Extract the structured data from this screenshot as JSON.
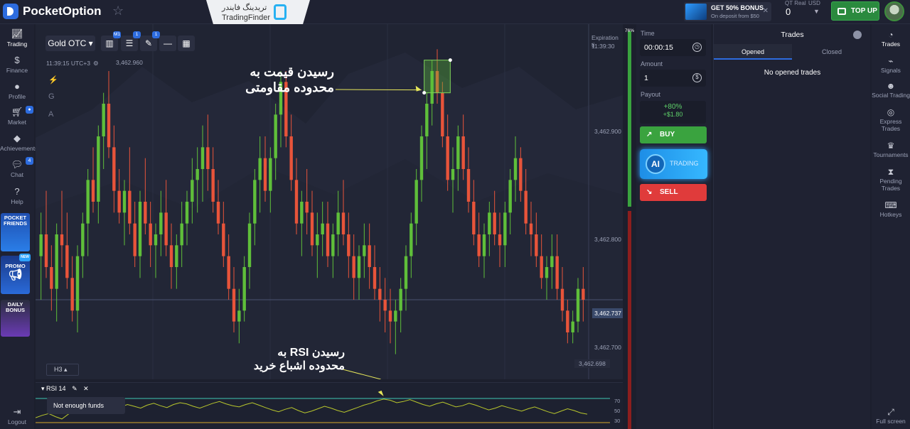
{
  "header": {
    "brand": "PocketOption",
    "watermark_fa": "تریدینگ فایندر",
    "watermark_en": "TradingFinder",
    "bonus_title": "GET 50% BONUS",
    "bonus_sub": "On deposit from $50",
    "account_type": "QT Real",
    "currency": "USD",
    "balance": "0",
    "topup_label": "TOP UP",
    "icons": {
      "favorite": "star-icon",
      "close": "close-icon",
      "topup": "wallet-icon"
    }
  },
  "left_nav": {
    "items": [
      {
        "label": "Trading",
        "icon": "chart-icon"
      },
      {
        "label": "Finance",
        "icon": "dollar-icon"
      },
      {
        "label": "Profile",
        "icon": "user-icon"
      },
      {
        "label": "Market",
        "icon": "cart-icon",
        "badge": ""
      },
      {
        "label": "Achievements",
        "icon": "diamond-icon"
      },
      {
        "label": "Chat",
        "icon": "chat-icon",
        "badge": "4"
      },
      {
        "label": "Help",
        "icon": "help-icon"
      }
    ],
    "promos": [
      {
        "label": "POCKET FRIENDS",
        "badge": ""
      },
      {
        "label": "PROMO",
        "badge": "NEW"
      },
      {
        "label": "DAILY BONUS",
        "badge": ""
      }
    ],
    "logout": "Logout"
  },
  "chart": {
    "asset": "Gold OTC",
    "toolbar_badges": [
      "M1",
      "1",
      "1"
    ],
    "time": "11:39:15 UTC+3",
    "price_top": "3,462.960",
    "side_tools": [
      "⚡",
      "G",
      "A"
    ],
    "expiration_label": "Expiration ti",
    "expiration_time": "11:39:30",
    "axis_prices": [
      "3,462.900",
      "3,462.800",
      "3,462.700"
    ],
    "current_price": "3,462.737",
    "low_price": "3,462.698",
    "timeframe": "H3",
    "annotation_top_fa": "رسیدن قیمت به\nمحدوده مقاومتی",
    "annotation_bottom_fa": "رسیدن RSI به\nمحدوده اشباع خرید",
    "progress_up_pct": "76%",
    "progress_up": 0.76
  },
  "chart_data": {
    "type": "candlestick",
    "ohlc": [
      [
        3462.78,
        3462.82,
        3462.74,
        3462.8
      ],
      [
        3462.8,
        3462.84,
        3462.76,
        3462.77
      ],
      [
        3462.77,
        3462.79,
        3462.73,
        3462.75
      ],
      [
        3462.75,
        3462.81,
        3462.72,
        3462.8
      ],
      [
        3462.8,
        3462.84,
        3462.77,
        3462.79
      ],
      [
        3462.79,
        3462.82,
        3462.75,
        3462.76
      ],
      [
        3462.76,
        3462.78,
        3462.72,
        3462.73
      ],
      [
        3462.73,
        3462.79,
        3462.71,
        3462.78
      ],
      [
        3462.78,
        3462.82,
        3462.76,
        3462.81
      ],
      [
        3462.81,
        3462.86,
        3462.78,
        3462.85
      ],
      [
        3462.85,
        3462.88,
        3462.82,
        3462.83
      ],
      [
        3462.83,
        3462.9,
        3462.81,
        3462.89
      ],
      [
        3462.89,
        3462.93,
        3462.86,
        3462.92
      ],
      [
        3462.92,
        3462.95,
        3462.87,
        3462.88
      ],
      [
        3462.88,
        3462.9,
        3462.82,
        3462.84
      ],
      [
        3462.84,
        3462.86,
        3462.81,
        3462.82
      ],
      [
        3462.82,
        3462.85,
        3462.79,
        3462.84
      ],
      [
        3462.84,
        3462.88,
        3462.8,
        3462.81
      ],
      [
        3462.81,
        3462.83,
        3462.77,
        3462.78
      ],
      [
        3462.78,
        3462.84,
        3462.76,
        3462.83
      ],
      [
        3462.83,
        3462.87,
        3462.8,
        3462.81
      ],
      [
        3462.81,
        3462.83,
        3462.77,
        3462.79
      ],
      [
        3462.79,
        3462.81,
        3462.76,
        3462.8
      ],
      [
        3462.8,
        3462.84,
        3462.78,
        3462.82
      ],
      [
        3462.82,
        3462.85,
        3462.78,
        3462.79
      ],
      [
        3462.79,
        3462.81,
        3462.75,
        3462.77
      ],
      [
        3462.77,
        3462.8,
        3462.75,
        3462.79
      ],
      [
        3462.79,
        3462.83,
        3462.77,
        3462.81
      ],
      [
        3462.81,
        3462.84,
        3462.79,
        3462.83
      ],
      [
        3462.83,
        3462.87,
        3462.81,
        3462.85
      ],
      [
        3462.85,
        3462.88,
        3462.82,
        3462.86
      ],
      [
        3462.86,
        3462.9,
        3462.83,
        3462.88
      ],
      [
        3462.88,
        3462.91,
        3462.84,
        3462.86
      ],
      [
        3462.86,
        3462.88,
        3462.82,
        3462.83
      ],
      [
        3462.83,
        3462.85,
        3462.8,
        3462.81
      ],
      [
        3462.81,
        3462.83,
        3462.77,
        3462.78
      ],
      [
        3462.78,
        3462.8,
        3462.74,
        3462.75
      ],
      [
        3462.75,
        3462.77,
        3462.71,
        3462.72
      ],
      [
        3462.72,
        3462.75,
        3462.7,
        3462.73
      ],
      [
        3462.73,
        3462.78,
        3462.72,
        3462.77
      ],
      [
        3462.77,
        3462.82,
        3462.75,
        3462.81
      ],
      [
        3462.81,
        3462.86,
        3462.79,
        3462.85
      ],
      [
        3462.85,
        3462.89,
        3462.82,
        3462.87
      ],
      [
        3462.87,
        3462.89,
        3462.83,
        3462.84
      ],
      [
        3462.84,
        3462.88,
        3462.82,
        3462.87
      ],
      [
        3462.87,
        3462.92,
        3462.85,
        3462.91
      ],
      [
        3462.91,
        3462.95,
        3462.88,
        3462.94
      ],
      [
        3462.94,
        3462.95,
        3462.88,
        3462.89
      ],
      [
        3462.89,
        3462.91,
        3462.84,
        3462.85
      ],
      [
        3462.85,
        3462.87,
        3462.8,
        3462.81
      ],
      [
        3462.81,
        3462.84,
        3462.78,
        3462.83
      ],
      [
        3462.83,
        3462.86,
        3462.8,
        3462.82
      ],
      [
        3462.82,
        3462.84,
        3462.78,
        3462.79
      ],
      [
        3462.79,
        3462.82,
        3462.76,
        3462.8
      ],
      [
        3462.8,
        3462.83,
        3462.78,
        3462.81
      ],
      [
        3462.81,
        3462.83,
        3462.77,
        3462.78
      ],
      [
        3462.78,
        3462.81,
        3462.76,
        3462.8
      ],
      [
        3462.8,
        3462.84,
        3462.78,
        3462.82
      ],
      [
        3462.82,
        3462.85,
        3462.79,
        3462.8
      ],
      [
        3462.8,
        3462.82,
        3462.76,
        3462.78
      ],
      [
        3462.78,
        3462.8,
        3462.74,
        3462.76
      ],
      [
        3462.76,
        3462.79,
        3462.74,
        3462.78
      ],
      [
        3462.78,
        3462.81,
        3462.76,
        3462.79
      ],
      [
        3462.79,
        3462.81,
        3462.75,
        3462.77
      ],
      [
        3462.77,
        3462.79,
        3462.74,
        3462.75
      ],
      [
        3462.75,
        3462.77,
        3462.72,
        3462.74
      ],
      [
        3462.74,
        3462.76,
        3462.71,
        3462.73
      ],
      [
        3462.73,
        3462.75,
        3462.7,
        3462.72
      ],
      [
        3462.72,
        3462.74,
        3462.69,
        3462.73
      ],
      [
        3462.73,
        3462.76,
        3462.71,
        3462.75
      ],
      [
        3462.75,
        3462.79,
        3462.73,
        3462.78
      ],
      [
        3462.78,
        3462.82,
        3462.76,
        3462.81
      ],
      [
        3462.81,
        3462.86,
        3462.79,
        3462.85
      ],
      [
        3462.85,
        3462.9,
        3462.83,
        3462.89
      ],
      [
        3462.89,
        3462.93,
        3462.86,
        3462.92
      ],
      [
        3462.92,
        3462.96,
        3462.9,
        3462.95
      ],
      [
        3462.95,
        3462.97,
        3462.92,
        3462.93
      ],
      [
        3462.93,
        3462.94,
        3462.88,
        3462.89
      ],
      [
        3462.89,
        3462.91,
        3462.84,
        3462.85
      ],
      [
        3462.85,
        3462.88,
        3462.82,
        3462.86
      ],
      [
        3462.86,
        3462.9,
        3462.84,
        3462.89
      ],
      [
        3462.89,
        3462.91,
        3462.85,
        3462.86
      ],
      [
        3462.86,
        3462.88,
        3462.82,
        3462.83
      ],
      [
        3462.83,
        3462.85,
        3462.79,
        3462.8
      ],
      [
        3462.8,
        3462.82,
        3462.77,
        3462.78
      ],
      [
        3462.78,
        3462.81,
        3462.76,
        3462.8
      ],
      [
        3462.8,
        3462.83,
        3462.78,
        3462.82
      ],
      [
        3462.82,
        3462.84,
        3462.79,
        3462.8
      ],
      [
        3462.8,
        3462.82,
        3462.77,
        3462.79
      ],
      [
        3462.79,
        3462.83,
        3462.77,
        3462.82
      ],
      [
        3462.82,
        3462.86,
        3462.8,
        3462.85
      ],
      [
        3462.85,
        3462.89,
        3462.83,
        3462.87
      ],
      [
        3462.87,
        3462.88,
        3462.83,
        3462.84
      ],
      [
        3462.84,
        3462.86,
        3462.8,
        3462.81
      ],
      [
        3462.81,
        3462.83,
        3462.78,
        3462.8
      ],
      [
        3462.8,
        3462.82,
        3462.77,
        3462.78
      ],
      [
        3462.78,
        3462.8,
        3462.75,
        3462.76
      ],
      [
        3462.76,
        3462.78,
        3462.74,
        3462.77
      ],
      [
        3462.77,
        3462.8,
        3462.75,
        3462.78
      ],
      [
        3462.78,
        3462.8,
        3462.74,
        3462.75
      ],
      [
        3462.75,
        3462.77,
        3462.72,
        3462.73
      ],
      [
        3462.73,
        3462.74,
        3462.7,
        3462.71
      ],
      [
        3462.71,
        3462.73,
        3462.7,
        3462.72
      ],
      [
        3462.72,
        3462.76,
        3462.71,
        3462.75
      ],
      [
        3462.75,
        3462.77,
        3462.72,
        3462.74
      ]
    ],
    "ylim": [
      3462.68,
      3462.98
    ],
    "bull_color": "#5fbf3a",
    "bear_color": "#e8543a",
    "resistance_zone": [
      3462.93,
      3462.96
    ]
  },
  "rsi": {
    "label": "RSI 14",
    "tooltip": "Not enough funds",
    "levels": [
      "70",
      "50",
      "30"
    ],
    "values": [
      38,
      42,
      45,
      40,
      36,
      44,
      50,
      47,
      52,
      55,
      49,
      53,
      58,
      56,
      60,
      57,
      54,
      59,
      62,
      58,
      55,
      60,
      63,
      61,
      57,
      54,
      58,
      62,
      65,
      61,
      58,
      56,
      60,
      63,
      59,
      55,
      51,
      48,
      52,
      55,
      50,
      46,
      49,
      53,
      57,
      54,
      50,
      47,
      51,
      55,
      59,
      62,
      66,
      69,
      67,
      63,
      65,
      68,
      64,
      60,
      57,
      61,
      64,
      60,
      56,
      58,
      62,
      59,
      55,
      51,
      54,
      58,
      55,
      52,
      49,
      53,
      56,
      52,
      48,
      45,
      49,
      53,
      50,
      46,
      44
    ]
  },
  "trade_panel": {
    "time_label": "Time",
    "time_value": "00:00:15",
    "amount_label": "Amount",
    "amount_value": "1",
    "payout_label": "Payout",
    "payout_pct": "+80%",
    "payout_usd": "+$1.80",
    "buy_label": "BUY",
    "ai_label": "AI",
    "ai_sub": "TRADING",
    "sell_label": "SELL",
    "colors": {
      "buy": "#3aa33f",
      "sell": "#e03b3b"
    }
  },
  "trades": {
    "title": "Trades",
    "tabs": [
      "Opened",
      "Closed"
    ],
    "empty": "No opened trades"
  },
  "right_nav": {
    "items": [
      {
        "label": "Trades",
        "icon": "trades-icon"
      },
      {
        "label": "Signals",
        "icon": "signals-icon"
      },
      {
        "label": "Social Trading",
        "icon": "social-icon"
      },
      {
        "label": "Express Trades",
        "icon": "express-icon"
      },
      {
        "label": "Tournaments",
        "icon": "trophy-icon"
      },
      {
        "label": "Pending Trades",
        "icon": "hourglass-icon"
      },
      {
        "label": "Hotkeys",
        "icon": "keyboard-icon"
      }
    ],
    "fullscreen": "Full screen"
  }
}
